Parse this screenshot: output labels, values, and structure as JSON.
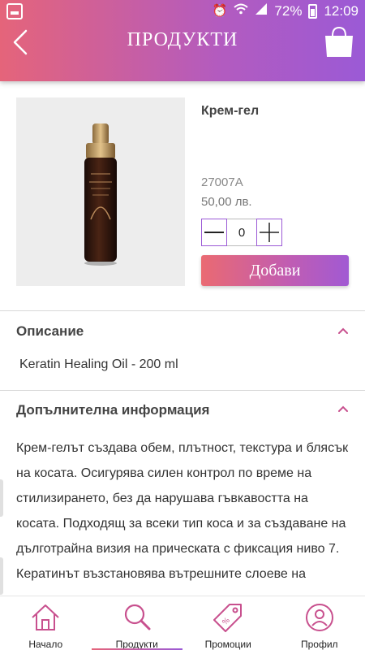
{
  "status_bar": {
    "battery_percent": "72%",
    "time": "12:09"
  },
  "header": {
    "title": "ПРОДУКТИ"
  },
  "product": {
    "name": "Крем-гел",
    "sku": "27007A",
    "price": "50,00 лв.",
    "quantity": "0",
    "add_label": "Добави"
  },
  "description": {
    "title": "Описание",
    "text": "Keratin Healing Oil - 200 ml"
  },
  "additional_info": {
    "title": "Допълнителна информация",
    "text": "Крем-гелът създава обем, плътност, текстура и блясък на косата. Осигурява силен контрол по време на стилизирането, без да нарушава гъвкавостта на косата. Подходящ за всеки тип коса и за създаване на дълготрайна визия на прическата с фиксация ниво 7. Кератинът възстановява вътрешните слоеве на косъма, за да го направи плътен и еластичен. Комплексът Phyto IV рехидратира косата, за да"
  },
  "tabs": [
    {
      "label": "Начало",
      "icon": "home-icon"
    },
    {
      "label": "Продукти",
      "icon": "search-icon",
      "active": true
    },
    {
      "label": "Промоции",
      "icon": "tag-icon"
    },
    {
      "label": "Профил",
      "icon": "profile-icon"
    }
  ],
  "colors": {
    "accent_start": "#e5647a",
    "accent_end": "#9b5ad6",
    "tab_icon": "#c8508e"
  }
}
